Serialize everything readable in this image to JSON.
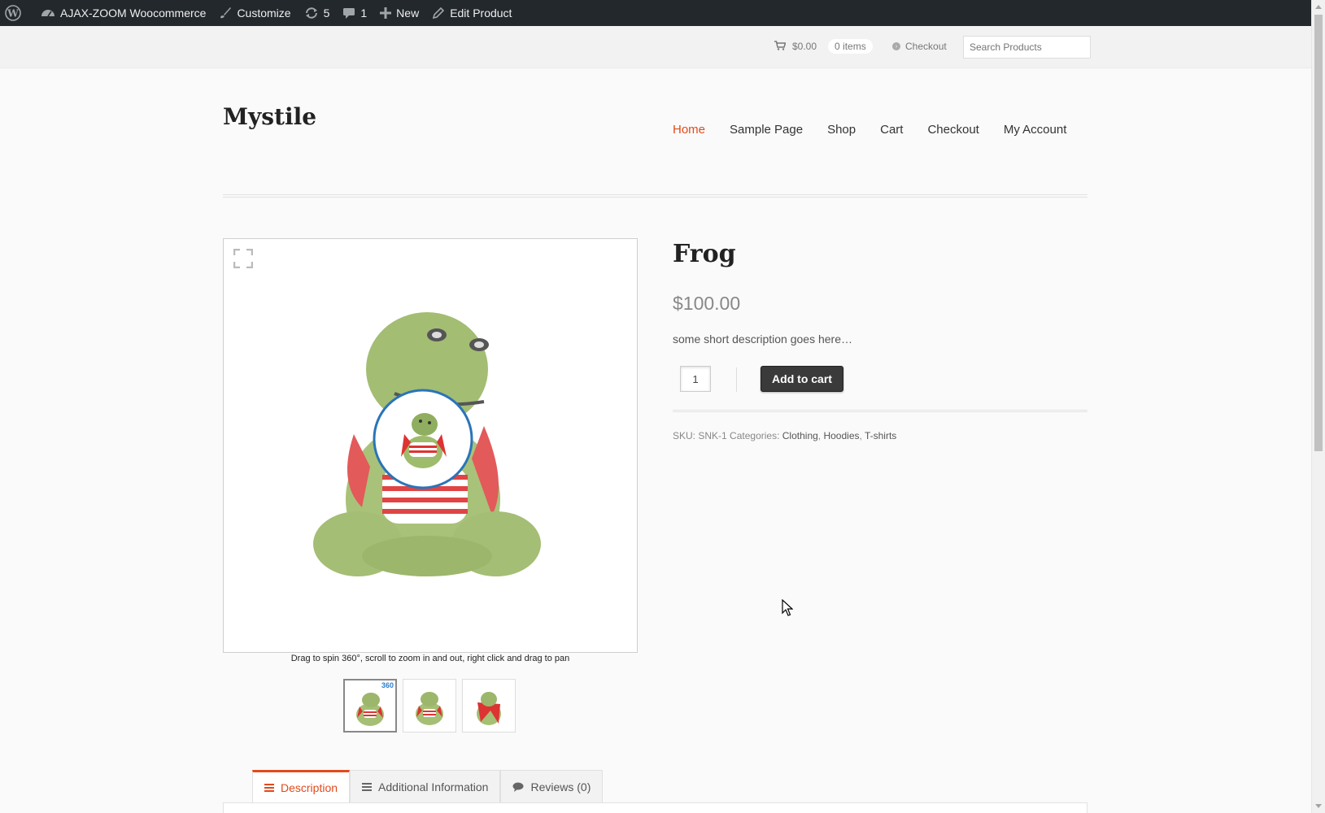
{
  "admin_bar": {
    "site_name": "AJAX-ZOOM Woocommerce",
    "customize": "Customize",
    "updates_count": "5",
    "comments_count": "1",
    "new": "New",
    "edit_product": "Edit Product"
  },
  "header": {
    "cart_amount": "$0.00",
    "cart_items": "0 items",
    "checkout": "Checkout",
    "search_placeholder": "Search Products",
    "site_title": "Mystile",
    "nav": [
      "Home",
      "Sample Page",
      "Shop",
      "Cart",
      "Checkout",
      "My Account"
    ],
    "active_nav": "Home"
  },
  "product": {
    "viewer_hint": "Drag to spin 360°, scroll to zoom in and out, right click and drag to pan",
    "thumb_badge": "360",
    "title": "Frog",
    "price": "$100.00",
    "short_description": "some short description goes here…",
    "quantity": "1",
    "add_to_cart": "Add to cart",
    "sku_label": "SKU:",
    "sku": "SNK-1",
    "categories_label": "Categories:",
    "categories": [
      "Clothing",
      "Hoodies",
      "T-shirts"
    ]
  },
  "tabs": [
    {
      "label": "Description",
      "icon": "list-icon",
      "active": true
    },
    {
      "label": "Additional Information",
      "icon": "list-icon",
      "active": false
    },
    {
      "label": "Reviews (0)",
      "icon": "comment-icon",
      "active": false
    }
  ],
  "colors": {
    "accent": "#e24a1b",
    "admin_bar": "#23282d",
    "button": "#3a3a3a"
  }
}
